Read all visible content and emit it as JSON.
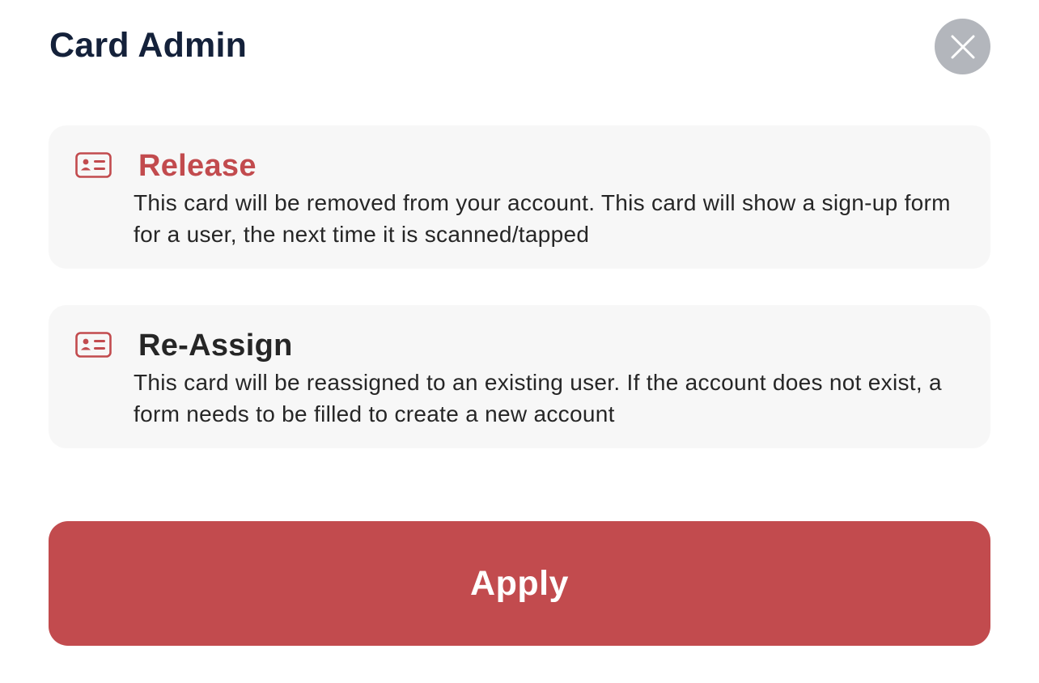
{
  "dialog": {
    "title": "Card Admin",
    "close_icon": "close-icon"
  },
  "options": [
    {
      "id": "release",
      "icon": "id-card-icon",
      "title": "Release",
      "title_color": "#c24b4e",
      "description": "This card will be removed from your account. This card will show a sign-up form for a user, the next time it is scanned/tapped"
    },
    {
      "id": "reassign",
      "icon": "id-card-icon",
      "title": "Re-Assign",
      "title_color": "#262626",
      "description": "This card will be reassigned to an existing user. If the account does not exist, a form needs to be filled to create a new account"
    }
  ],
  "apply_button": {
    "label": "Apply",
    "color": "#c24b4e"
  },
  "colors": {
    "accent": "#c24b4e",
    "close_button_bg": "#b3b6bc",
    "card_bg": "#f7f7f7",
    "title_text": "#14213a"
  }
}
